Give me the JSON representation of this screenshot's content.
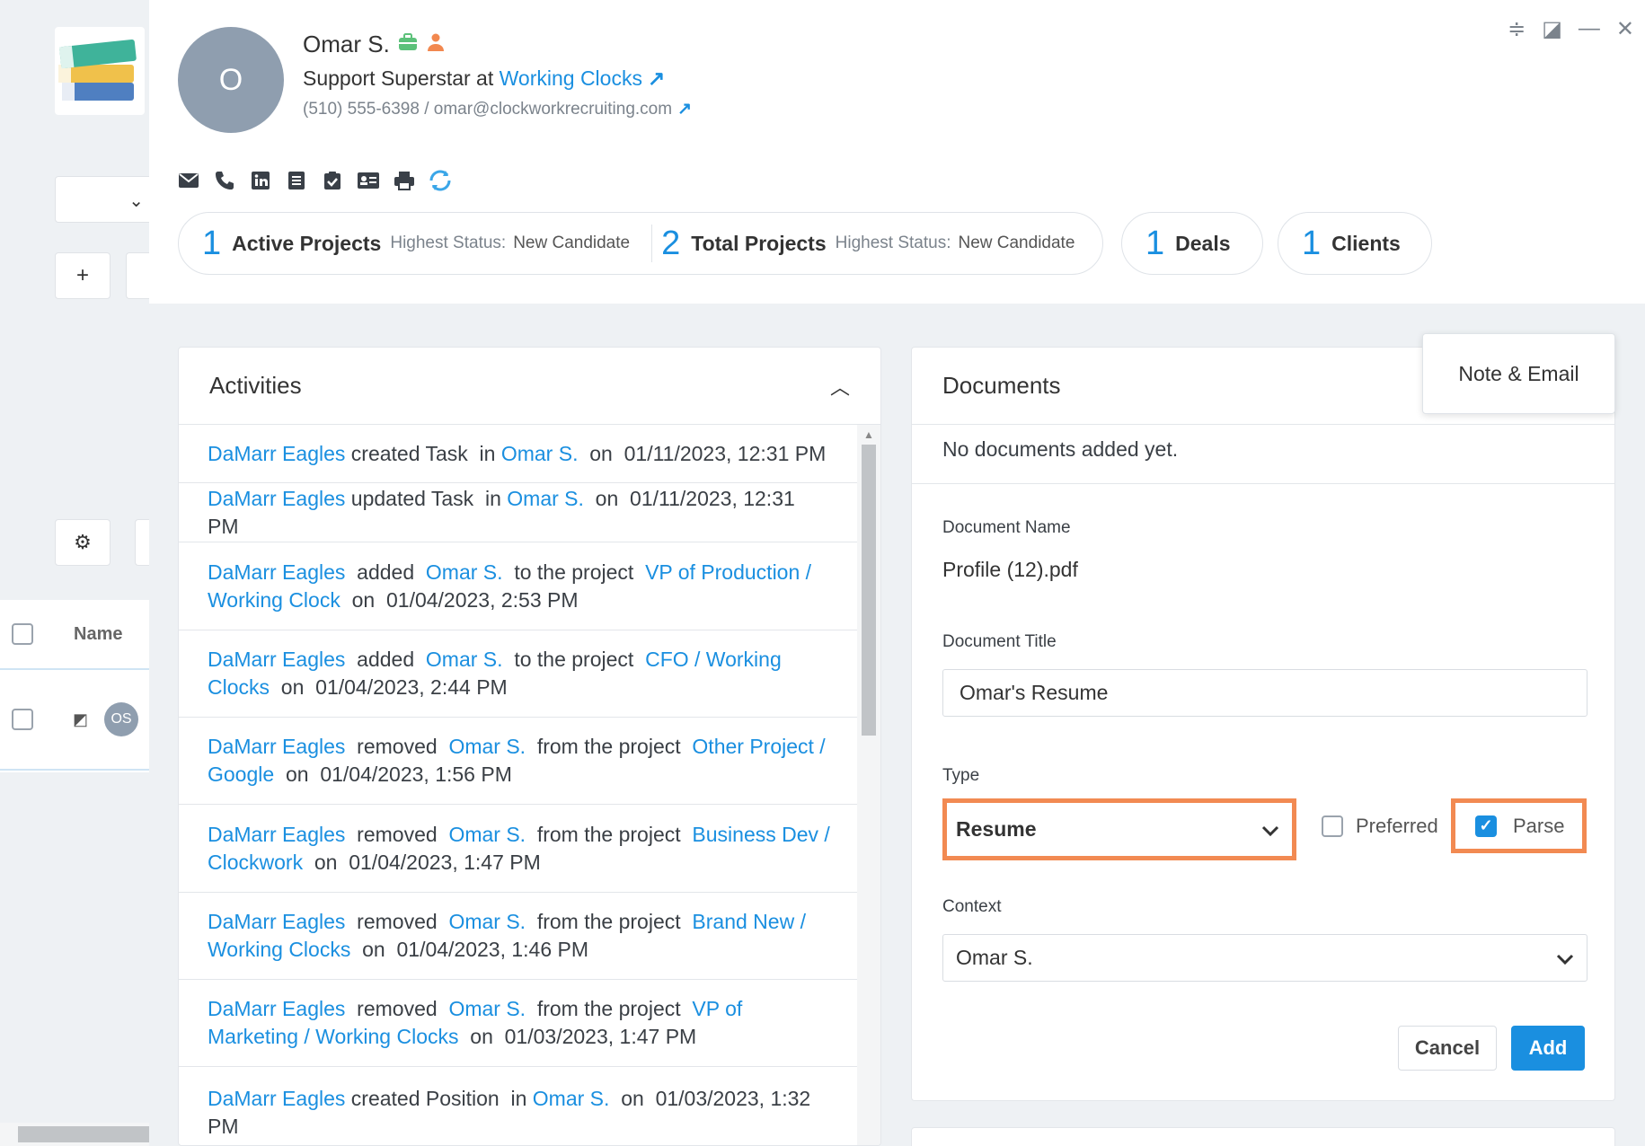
{
  "background": {
    "table_header": "Name",
    "row_avatar": "OS"
  },
  "contact": {
    "avatar_initial": "O",
    "name": "Omar S.",
    "title_prefix": "Support Superstar at",
    "company": "Working Clocks",
    "phone_email": "(510) 555-6398 / omar@clockworkrecruiting.com"
  },
  "stats": {
    "active": {
      "count": "1",
      "label": "Active Projects",
      "hs_label": "Highest Status:",
      "hs_value": "New Candidate"
    },
    "total": {
      "count": "2",
      "label": "Total Projects",
      "hs_label": "Highest Status:",
      "hs_value": "New Candidate"
    },
    "deals": {
      "count": "1",
      "label": "Deals"
    },
    "clients": {
      "count": "1",
      "label": "Clients"
    }
  },
  "activities": {
    "title": "Activities",
    "items": [
      {
        "actor": "DaMarr Eagles",
        "text1": " created Task  in ",
        "link1": "Omar S.",
        "text2": "  on  01/11/2023, 12:31 PM",
        "link2": "",
        "text3": ""
      },
      {
        "actor": "DaMarr Eagles",
        "text1": " updated Task  in ",
        "link1": "Omar S.",
        "text2": "  on  01/11/2023, 12:31 PM",
        "link2": "",
        "text3": ""
      },
      {
        "actor": "DaMarr Eagles",
        "text1": "  added  ",
        "link1": "Omar S.",
        "text2": "  to the project  ",
        "link2": "VP of Production / Working Clock",
        "text3": "  on  01/04/2023, 2:53 PM"
      },
      {
        "actor": "DaMarr Eagles",
        "text1": "  added  ",
        "link1": "Omar S.",
        "text2": "  to the project  ",
        "link2": "CFO / Working Clocks",
        "text3": "  on  01/04/2023, 2:44 PM"
      },
      {
        "actor": "DaMarr Eagles",
        "text1": "  removed  ",
        "link1": "Omar S.",
        "text2": "  from the project  ",
        "link2": "Other Project / Google",
        "text3": "  on  01/04/2023, 1:56 PM"
      },
      {
        "actor": "DaMarr Eagles",
        "text1": "  removed  ",
        "link1": "Omar S.",
        "text2": "  from the project  ",
        "link2": "Business Dev / Clockwork",
        "text3": "  on  01/04/2023, 1:47 PM"
      },
      {
        "actor": "DaMarr Eagles",
        "text1": "  removed  ",
        "link1": "Omar S.",
        "text2": "  from the project  ",
        "link2": "Brand New / Working Clocks",
        "text3": "  on  01/04/2023, 1:46 PM"
      },
      {
        "actor": "DaMarr Eagles",
        "text1": "  removed  ",
        "link1": "Omar S.",
        "text2": "  from the project  ",
        "link2": "VP of Marketing / Working Clocks",
        "text3": "  on  01/03/2023, 1:47 PM"
      },
      {
        "actor": "DaMarr Eagles",
        "text1": " created Position  in ",
        "link1": "Omar S.",
        "text2": "  on  01/03/2023, 1:32 PM",
        "link2": "",
        "text3": ""
      }
    ]
  },
  "documents": {
    "title": "Documents",
    "empty_text": "No documents added yet.",
    "doc_name_label": "Document Name",
    "doc_name": "Profile (12).pdf",
    "doc_title_label": "Document Title",
    "doc_title_value": "Omar's Resume",
    "type_label": "Type",
    "type_value": "Resume",
    "preferred_label": "Preferred",
    "preferred_checked": false,
    "parse_label": "Parse",
    "parse_checked": true,
    "context_label": "Context",
    "context_value": "Omar S.",
    "cancel_label": "Cancel",
    "add_label": "Add"
  },
  "note_email_label": "Note & Email",
  "colors": {
    "link": "#1a8fe0",
    "highlight": "#f28a52",
    "avatar": "#8f9eaf"
  }
}
